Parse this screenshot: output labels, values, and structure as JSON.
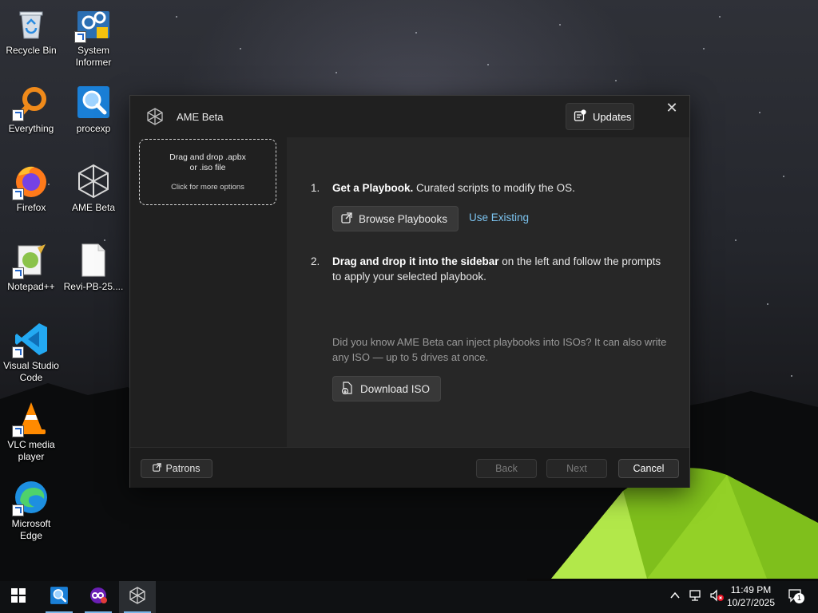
{
  "desktop": {
    "icons": [
      {
        "label": "Recycle Bin"
      },
      {
        "label": "System Informer"
      },
      {
        "label": "Everything"
      },
      {
        "label": "procexp"
      },
      {
        "label": "Firefox"
      },
      {
        "label": "AME Beta"
      },
      {
        "label": "Notepad++"
      },
      {
        "label": "Revi-PB-25...."
      },
      {
        "label": "Visual Studio Code"
      },
      {
        "label": "VLC media player"
      },
      {
        "label": "Microsoft Edge"
      }
    ]
  },
  "window": {
    "title": "AME Beta",
    "updates_label": "Updates",
    "close_glyph": "✕",
    "sidebar": {
      "drop_line1": "Drag and drop .apbx",
      "drop_line2": "or .iso file",
      "drop_hint": "Click for more options"
    },
    "steps": [
      {
        "num": "1.",
        "bold": "Get a Playbook.",
        "text": " Curated scripts to modify the OS."
      },
      {
        "num": "2.",
        "bold": "Drag and drop it into the sidebar",
        "text": " on the left and follow the prompts to apply your selected playbook."
      }
    ],
    "browse_label": "Browse Playbooks",
    "use_existing_label": "Use Existing",
    "tip_text": "Did you know AME Beta can inject playbooks into ISOs? It can also write any ISO — up to 5 drives at once.",
    "download_iso_label": "Download ISO",
    "footer": {
      "patrons_label": "Patrons",
      "back_label": "Back",
      "next_label": "Next",
      "cancel_label": "Cancel"
    }
  },
  "taskbar": {
    "time": "11:49 PM",
    "date": "10/27/2025",
    "notification_count": "1"
  },
  "colors": {
    "accent_link": "#7cc4f0",
    "window_bg": "#202020",
    "main_bg": "#272727",
    "tent_green": "#8ed11e"
  }
}
